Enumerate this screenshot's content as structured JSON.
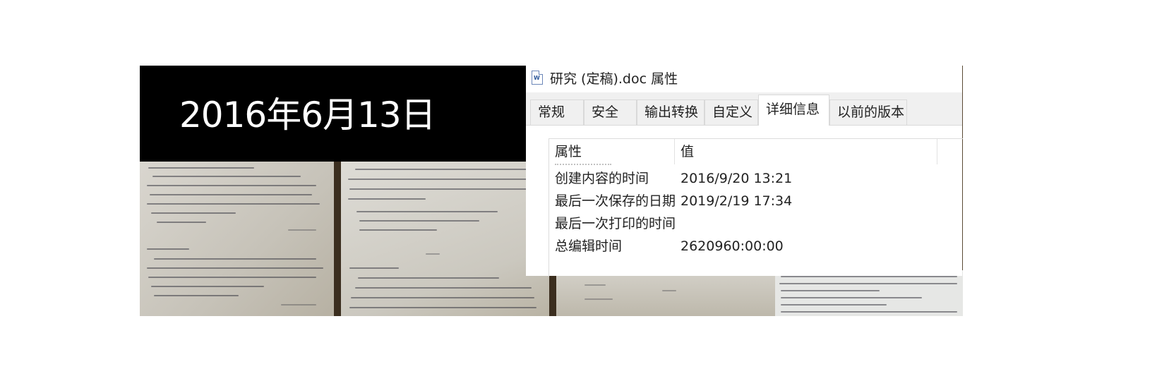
{
  "photo": {
    "date_caption": "2016年6月13日"
  },
  "dialog": {
    "title": "研究  (定稿).doc 属性",
    "tabs": [
      {
        "label": "常规"
      },
      {
        "label": "安全"
      },
      {
        "label": "输出转换"
      },
      {
        "label": "自定义"
      },
      {
        "label": "详细信息",
        "active": true
      },
      {
        "label": "以前的版本"
      }
    ],
    "columns": {
      "property": "属性",
      "value": "值"
    },
    "rows": [
      {
        "name": "创建内容的时间",
        "value": "2016/9/20 13:21"
      },
      {
        "name": "最后一次保存的日期",
        "value": "2019/2/19 17:34"
      },
      {
        "name": "最后一次打印的时间",
        "value": ""
      },
      {
        "name": "总编辑时间",
        "value": "2620960:00:00"
      }
    ]
  }
}
